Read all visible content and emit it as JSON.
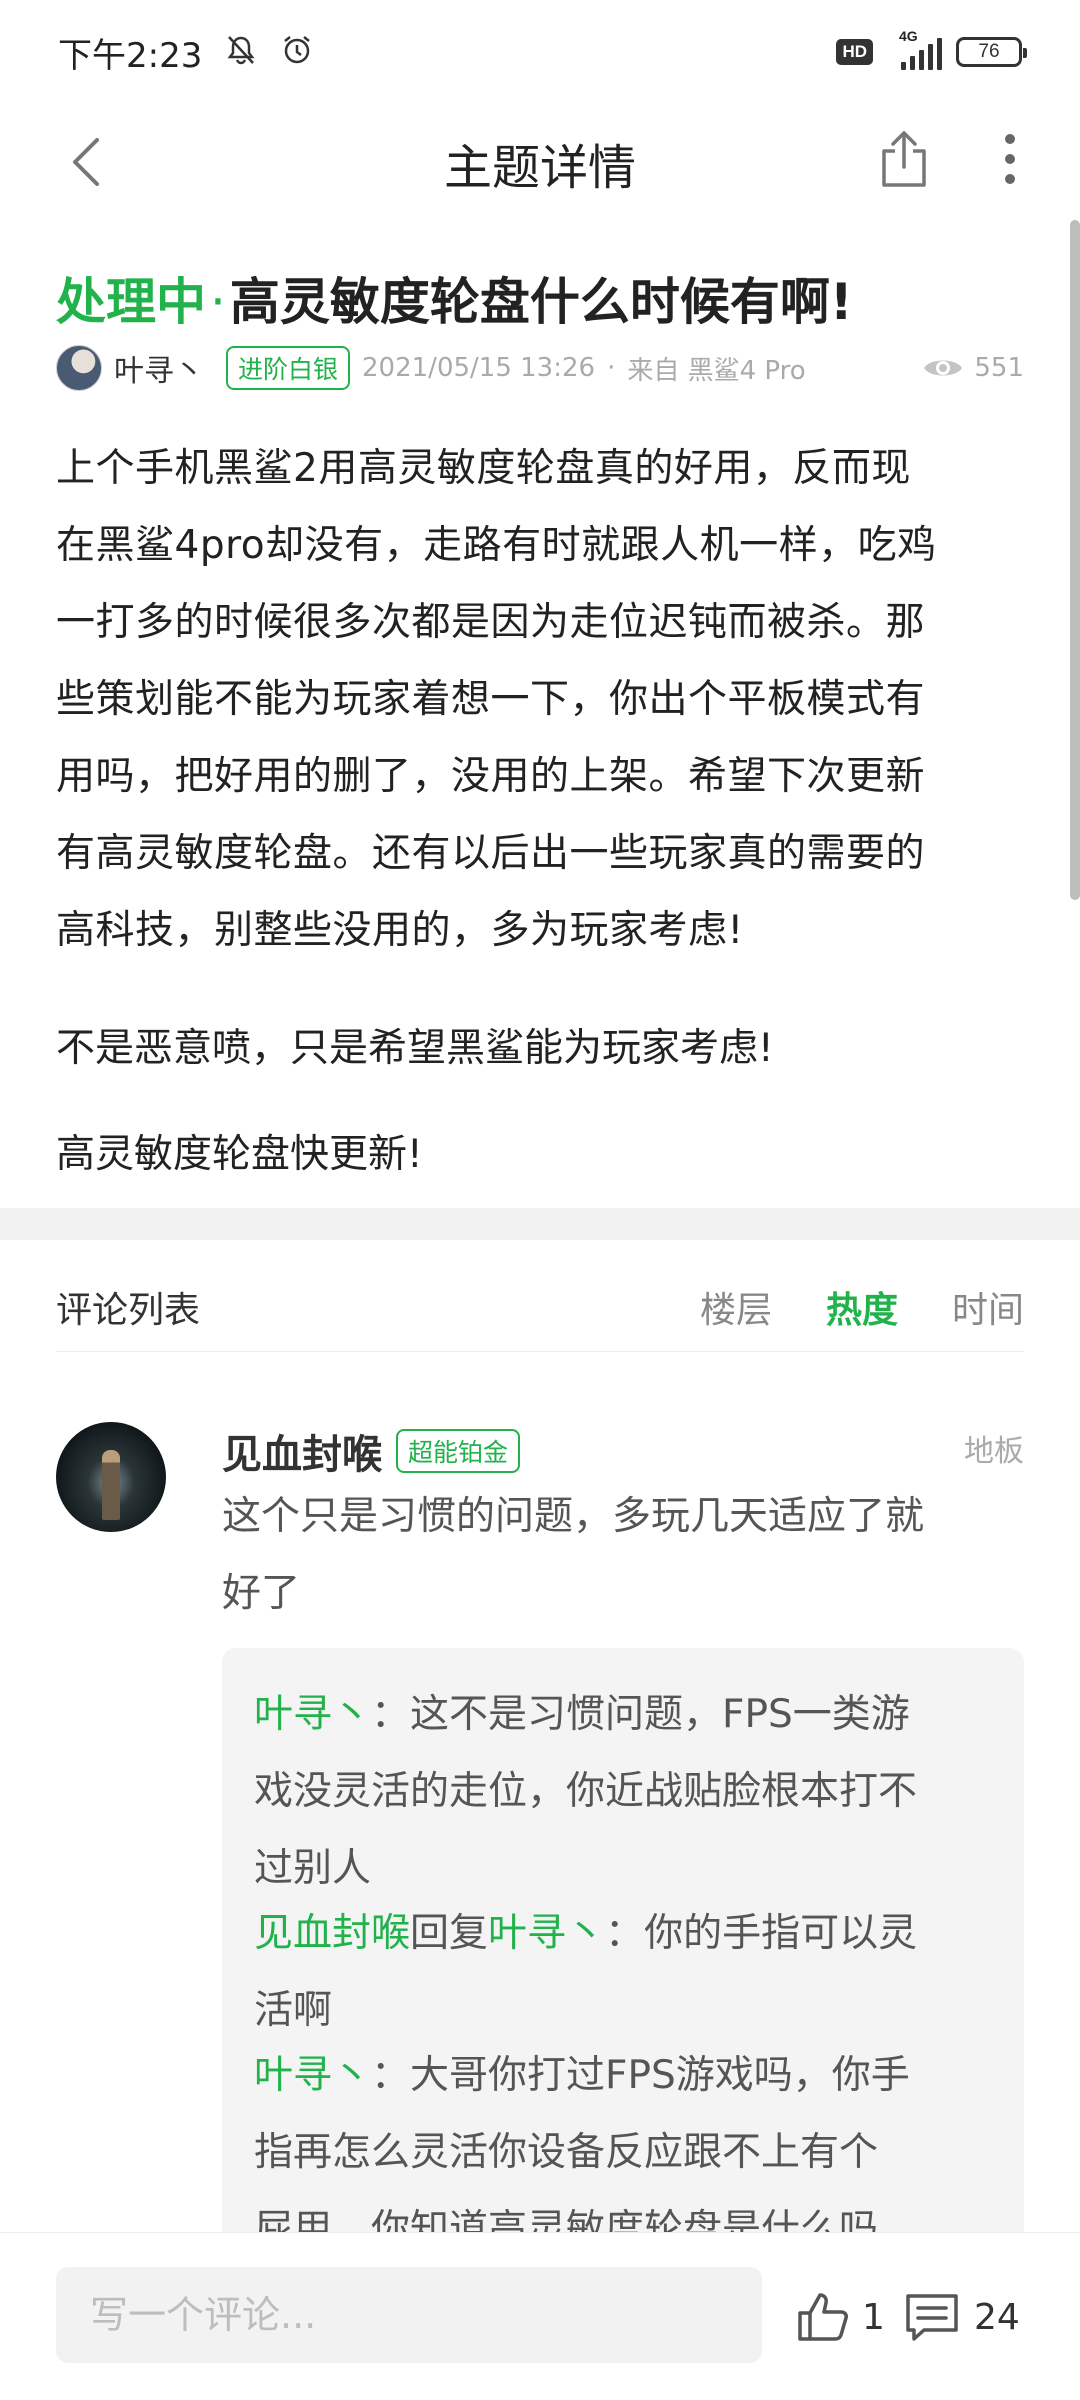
{
  "status_bar": {
    "time": "下午2:23",
    "hd": "HD",
    "network": "4G",
    "battery": "76"
  },
  "nav": {
    "title": "主题详情"
  },
  "post": {
    "status": "处理中",
    "dot": "·",
    "title": "高灵敏度轮盘什么时候有啊!",
    "author": "叶寻丶",
    "author_badge": "进阶白银",
    "date": "2021/05/15 13:26",
    "sep": "·",
    "source": "来自 黑鲨4 Pro",
    "views": "551",
    "body_lines": [
      "上个手机黑鲨2用高灵敏度轮盘真的好用，反而现",
      "在黑鲨4pro却没有，走路有时就跟人机一样，吃鸡",
      "一打多的时候很多次都是因为走位迟钝而被杀。那",
      "些策划能不能为玩家着想一下，你出个平板模式有",
      "用吗，把好用的删了，没用的上架。希望下次更新",
      "有高灵敏度轮盘。还有以后出一些玩家真的需要的",
      "高科技，别整些没用的，多为玩家考虑!"
    ],
    "paragraph2": "不是恶意喷，只是希望黑鲨能为玩家考虑!",
    "paragraph3": "高灵敏度轮盘快更新!"
  },
  "comments": {
    "title": "评论列表",
    "sort_floor": "楼层",
    "sort_hot": "热度",
    "sort_time": "时间",
    "items": [
      {
        "author": "见血封喉",
        "badge": "超能铂金",
        "floor": "地板",
        "text_lines": [
          "这个只是习惯的问题，多玩几天适应了就",
          "好了"
        ],
        "replies": [
          {
            "from": "叶寻丶",
            "to": "",
            "connector": "",
            "colon": "：",
            "text_lines": [
              "这不是习惯问题，FPS一类游",
              "戏没灵活的走位，你近战贴脸根本打不",
              "过别人"
            ]
          },
          {
            "from": "见血封喉",
            "to": "叶寻丶",
            "connector": "回复",
            "colon": "：",
            "text_lines": [
              "你的手指可以灵",
              "活啊"
            ]
          },
          {
            "from": "叶寻丶",
            "to": "",
            "connector": "",
            "colon": "：",
            "text_lines": [
              "大哥你打过FPS游戏吗，你手",
              "指再怎么灵活你设备反应跟不上有个",
              "屁用，你知道高灵敏度轮盘是什么吗"
            ]
          }
        ]
      }
    ]
  },
  "bottom_bar": {
    "placeholder": "写一个评论...",
    "likes": "1",
    "comments_count": "24"
  },
  "colors": {
    "accent": "#21b24b",
    "text": "#222222",
    "muted": "#aaaaaa"
  },
  "icons": [
    "bell-off-icon",
    "alarm-icon",
    "signal-icon",
    "battery-icon",
    "back-icon",
    "share-icon",
    "more-icon",
    "eye-icon",
    "thumb-up-icon",
    "comment-icon"
  ]
}
